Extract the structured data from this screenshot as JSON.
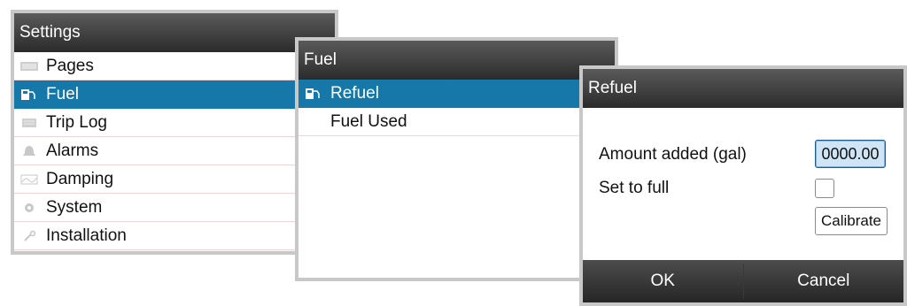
{
  "settings": {
    "title": "Settings",
    "items": [
      {
        "label": "Pages",
        "icon": "pages-icon"
      },
      {
        "label": "Fuel",
        "icon": "fuel-pump-icon",
        "selected": true
      },
      {
        "label": "Trip Log",
        "icon": "trip-log-icon"
      },
      {
        "label": "Alarms",
        "icon": "bell-icon"
      },
      {
        "label": "Damping",
        "icon": "damping-icon"
      },
      {
        "label": "System",
        "icon": "gear-icon"
      },
      {
        "label": "Installation",
        "icon": "wrench-icon"
      }
    ]
  },
  "fuel": {
    "title": "Fuel",
    "items": [
      {
        "label": "Refuel",
        "icon": "fuel-pump-icon",
        "selected": true
      },
      {
        "label": "Fuel Used"
      }
    ]
  },
  "refuel": {
    "title": "Refuel",
    "amount_label": "Amount added  (gal)",
    "amount_value": "0000.00",
    "set_full_label": "Set to full",
    "calibrate_label": "Calibrate",
    "ok_label": "OK",
    "cancel_label": "Cancel"
  },
  "colors": {
    "selection": "#1578a8",
    "titlebar": "#3a3a3a",
    "divider": "#f0d6d6"
  }
}
